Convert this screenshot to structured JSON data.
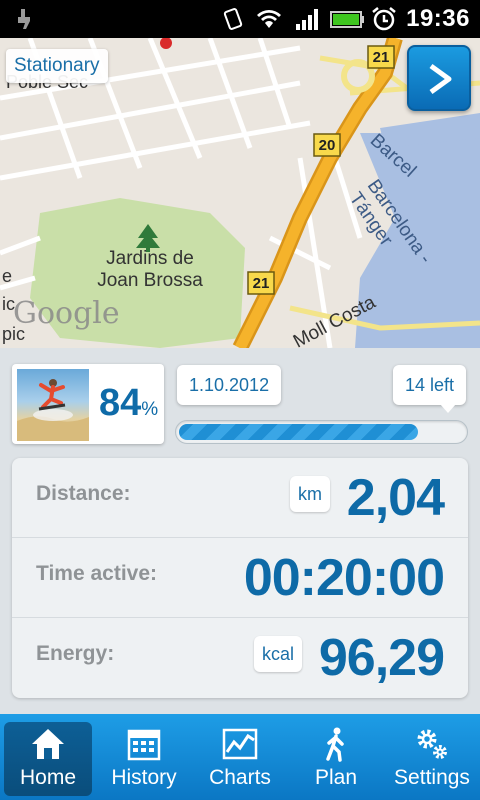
{
  "status_bar": {
    "time": "19:36",
    "icons": [
      "usb-debug-icon",
      "vibrate-icon",
      "wifi-icon",
      "signal-icon",
      "battery-icon",
      "alarm-icon"
    ]
  },
  "map": {
    "mode_label": "Stationary",
    "play_icon": "play-arrow-icon",
    "attribution": "Google",
    "park_label_line1": "Jardins de",
    "park_label_line2": "Joan Brossa",
    "street_top_left": "Poble Sec",
    "street_right": "Barcelona - Tánger",
    "street_right_top": "Barcel",
    "street_bottom": "Moll Costa",
    "edge_left_1": "e",
    "edge_left_2": "ic",
    "edge_left_3": "pic",
    "road_markers": [
      "21",
      "20",
      "21"
    ]
  },
  "progress": {
    "percent_value": "84",
    "percent_sign": "%",
    "date": "1.10.2012",
    "left_text": "14 left",
    "fill_fraction": 0.84
  },
  "stats": {
    "distance_label": "Distance:",
    "distance_unit": "km",
    "distance_value": "2,04",
    "time_label": "Time active:",
    "time_value": "00:20:00",
    "energy_label": "Energy:",
    "energy_unit": "kcal",
    "energy_value": "96,29"
  },
  "nav": {
    "items": [
      {
        "label": "Home",
        "icon": "home-icon",
        "active": true
      },
      {
        "label": "History",
        "icon": "calendar-icon",
        "active": false
      },
      {
        "label": "Charts",
        "icon": "chart-icon",
        "active": false
      },
      {
        "label": "Plan",
        "icon": "walker-icon",
        "active": false
      },
      {
        "label": "Settings",
        "icon": "gears-icon",
        "active": false
      }
    ]
  },
  "colors": {
    "accent": "#0e6aa7",
    "nav_bg": "#1e9de6",
    "nav_active": "#0d5f96",
    "panel_bg": "#dde2e6",
    "map_water": "#a9bfe2",
    "map_park": "#c9dfa8",
    "map_highway": "#f5b32b"
  }
}
